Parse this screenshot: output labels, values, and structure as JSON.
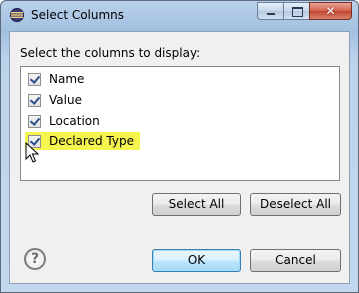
{
  "window": {
    "title": "Select Columns",
    "close_glyph": "✕"
  },
  "dialog": {
    "instructions": "Select the columns to display:",
    "columns": [
      {
        "label": "Name",
        "checked": true
      },
      {
        "label": "Value",
        "checked": true
      },
      {
        "label": "Location",
        "checked": true
      },
      {
        "label": "Declared Type",
        "checked": true,
        "highlighted": true
      }
    ],
    "select_all_label": "Select All",
    "deselect_all_label": "Deselect All",
    "ok_label": "OK",
    "cancel_label": "Cancel",
    "help_glyph": "?"
  },
  "colors": {
    "highlight": "#f6f44e",
    "default_button_border": "#3c7fb1"
  },
  "icons": {
    "title": "eclipse-app-icon",
    "help": "help-icon",
    "cursor": "mouse-pointer-icon"
  }
}
